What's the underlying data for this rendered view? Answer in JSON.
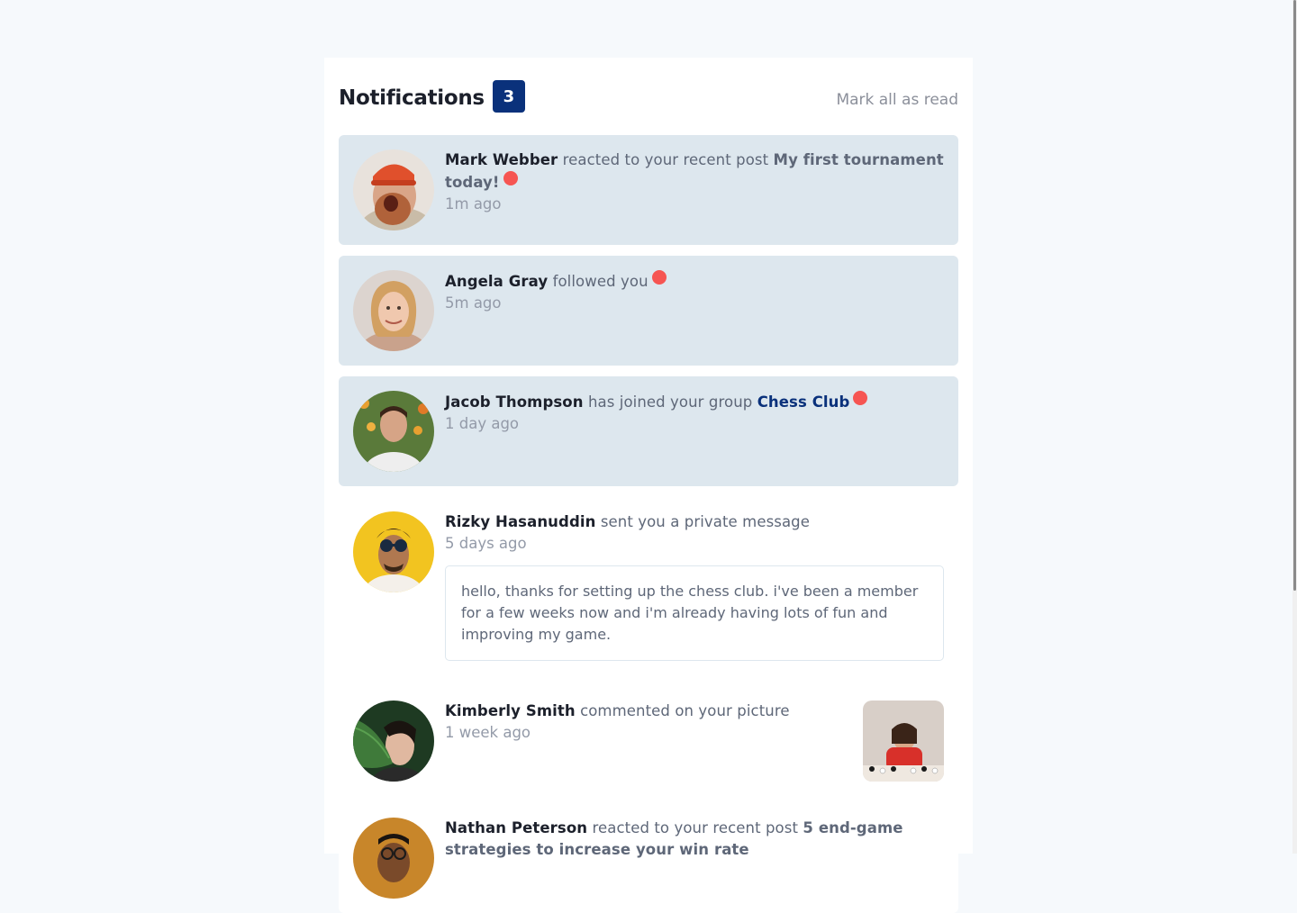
{
  "header": {
    "title": "Notifications",
    "unread_count": "3",
    "mark_all_label": "Mark all as read"
  },
  "notifications": [
    {
      "name": "Mark Webber",
      "action": "reacted to your recent post",
      "target": "My first tournament today!",
      "time": "1m ago",
      "unread": true
    },
    {
      "name": "Angela Gray",
      "action": "followed you",
      "time": "5m ago",
      "unread": true
    },
    {
      "name": "Jacob Thompson",
      "action": "has joined your group",
      "target": "Chess Club",
      "time": "1 day ago",
      "unread": true
    },
    {
      "name": "Rizky Hasanuddin",
      "action": "sent you a private message",
      "time": "5 days ago",
      "message": "hello, thanks for setting up the chess club. i've been a member for a few weeks now and i'm already having lots of fun and improving my game.",
      "unread": false
    },
    {
      "name": "Kimberly Smith",
      "action": "commented on your picture",
      "time": "1 week ago",
      "unread": false
    },
    {
      "name": "Nathan Peterson",
      "action": "reacted to your recent post",
      "target": "5 end-game strategies to increase your win rate",
      "unread": false
    }
  ],
  "colors": {
    "page_bg": "#f6f9fc",
    "unread_bg": "#dde7ee",
    "badge": "#0a317b",
    "dot": "#f65552",
    "name": "#1c202b",
    "text": "#5e6778",
    "muted": "#939aa8"
  }
}
